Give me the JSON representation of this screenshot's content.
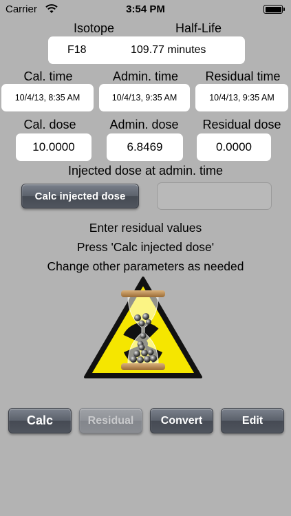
{
  "status_bar": {
    "carrier": "Carrier",
    "time": "3:54 PM"
  },
  "isotope": {
    "isotope_label": "Isotope",
    "halflife_label": "Half-Life",
    "isotope_value": "F18",
    "halflife_value": "109.77 minutes"
  },
  "times": {
    "cal_label": "Cal. time",
    "admin_label": "Admin. time",
    "residual_label": "Residual time",
    "cal_value": "10/4/13, 8:35 AM",
    "admin_value": "10/4/13, 9:35 AM",
    "residual_value": "10/4/13, 9:35 AM"
  },
  "doses": {
    "cal_label": "Cal. dose",
    "admin_label": "Admin. dose",
    "residual_label": "Residual dose",
    "cal_value": "10.0000",
    "admin_value": "6.8469",
    "residual_value": "0.0000"
  },
  "injected": {
    "label": "Injected dose at admin. time",
    "button_label": "Calc injected dose",
    "result_value": ""
  },
  "instructions": [
    "Enter residual values",
    "Press 'Calc injected dose'",
    "Change other parameters as needed"
  ],
  "toolbar": {
    "calc_label": "Calc",
    "residual_label": "Residual",
    "convert_label": "Convert",
    "edit_label": "Edit"
  },
  "colors": {
    "background": "#b3b3b3",
    "warning_yellow": "#f5e600",
    "button_dark": "#50555e"
  },
  "icons": [
    "wifi-icon",
    "battery-icon",
    "radiation-hourglass-icon"
  ]
}
